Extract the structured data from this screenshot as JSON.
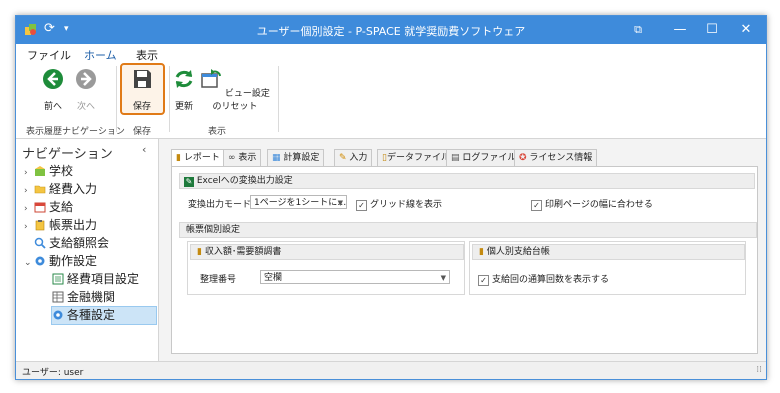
{
  "window": {
    "title": "ユーザー個別設定 - P-SPACE 就学奨励費ソフトウェア",
    "controls": {
      "restore": "⧉",
      "minimize": "—",
      "maximize": "☐",
      "close": "✕"
    }
  },
  "menu": {
    "items": [
      "ファイル",
      "ホーム",
      "表示"
    ],
    "active": "ホーム"
  },
  "ribbon": {
    "buttons": {
      "back": "前へ",
      "forward": "次へ",
      "save": "保存",
      "refresh": "更新",
      "reset_view": "ビュー設定のリセット"
    },
    "groups": {
      "nav": "表示履歴ナビゲーション",
      "save": "保存",
      "view": "表示"
    }
  },
  "navigation": {
    "title": "ナビゲーション",
    "collapse": "‹",
    "items": [
      {
        "label": "学校",
        "expandable": true
      },
      {
        "label": "経費入力",
        "expandable": true
      },
      {
        "label": "支給",
        "expandable": true
      },
      {
        "label": "帳票出力",
        "expandable": true
      },
      {
        "label": "支給額照会",
        "expandable": false
      },
      {
        "label": "動作設定",
        "expandable": true,
        "expanded": true
      },
      {
        "label": "経費項目設定",
        "child": true
      },
      {
        "label": "金融機関",
        "child": true
      },
      {
        "label": "各種設定",
        "child": true,
        "selected": true
      }
    ]
  },
  "tabs": [
    "レポート",
    "表示",
    "計算設定",
    "入力",
    "データファイル",
    "ログファイル",
    "ライセンス情報"
  ],
  "report": {
    "excel_section": "Excelへの変換出力設定",
    "mode_label": "変換出力モード",
    "mode_value": "1ページを1シートに…",
    "grid_label": "グリッド線を表示",
    "grid_checked": true,
    "fit_label": "印刷ページの幅に合わせる",
    "fit_checked": true,
    "individual_section": "帳票個別設定",
    "income_section": "収入額･需要額調書",
    "sort_label": "整理番号",
    "sort_value": "空欄",
    "ledger_section": "個人別支給台帳",
    "count_label": "支給回の通算回数を表示する",
    "count_checked": true
  },
  "status": {
    "user": "ユーザー: user",
    "grip": "⁞⁞"
  },
  "colors": {
    "titlebar": "#3e8bdb",
    "highlight": "#e07a17",
    "selection": "#cce4f7"
  }
}
